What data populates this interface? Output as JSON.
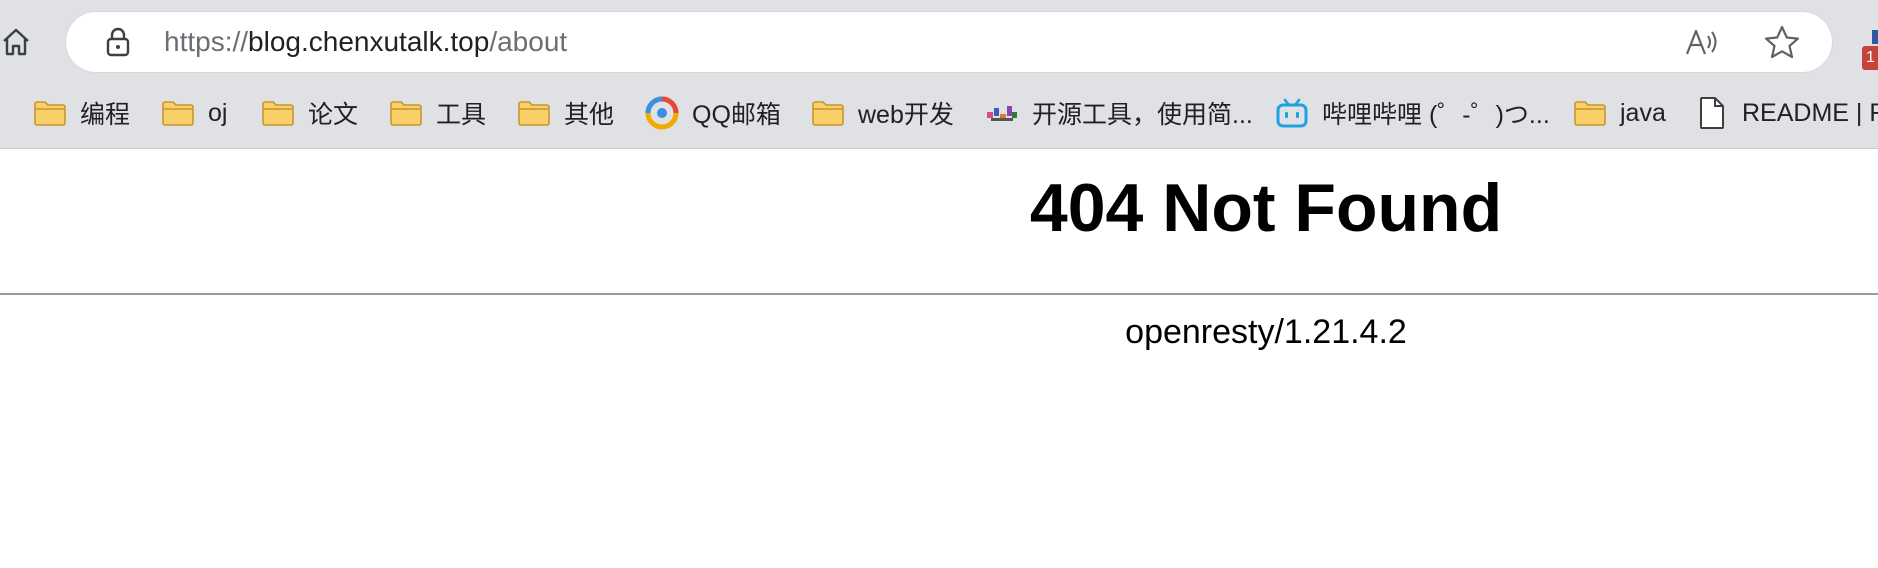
{
  "browser": {
    "url_scheme": "https://",
    "url_host": "blog.chenxutalk.top",
    "url_path": "/about",
    "extension_badge": "1"
  },
  "bookmarks": [
    {
      "label": "编程",
      "icon": "folder-icon"
    },
    {
      "label": "oj",
      "icon": "folder-icon"
    },
    {
      "label": "论文",
      "icon": "folder-icon"
    },
    {
      "label": "工具",
      "icon": "folder-icon"
    },
    {
      "label": "其他",
      "icon": "folder-icon"
    },
    {
      "label": "QQ邮箱",
      "icon": "qq-mail-icon"
    },
    {
      "label": "web开发",
      "icon": "folder-icon"
    },
    {
      "label": "开源工具，使用简...",
      "icon": "site-favicon-icon"
    },
    {
      "label": "哔哩哔哩 (゜-゜)つ...",
      "icon": "bilibili-icon"
    },
    {
      "label": "java",
      "icon": "folder-icon"
    },
    {
      "label": "README | Ri",
      "icon": "document-icon"
    }
  ],
  "page": {
    "heading": "404 Not Found",
    "server": "openresty/1.21.4.2"
  },
  "colors": {
    "chrome_background": "#dfe1e5",
    "folder_fill": "#f7d06a",
    "folder_stroke": "#d4a53a",
    "rule": "#9a9a9a"
  }
}
